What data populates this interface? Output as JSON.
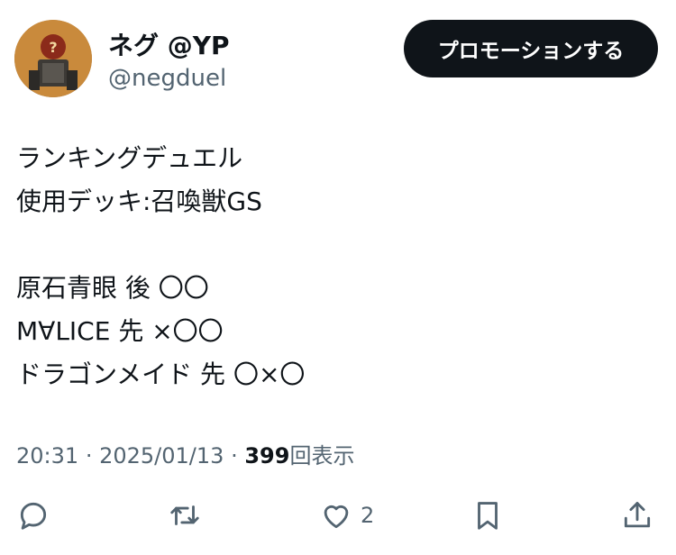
{
  "author": {
    "display_name": "ネグ @YP",
    "handle": "@negduel",
    "avatar_icon": "avatar-icon"
  },
  "header": {
    "promote_label": "プロモーションする"
  },
  "tweet": {
    "lines": [
      "ランキングデュエル",
      "使用デッキ:召喚獣GS",
      "",
      "原石青眼 後 〇〇",
      "M∀LICE 先 ×〇〇",
      "ドラゴンメイド 先 〇×〇"
    ]
  },
  "meta": {
    "time": "20:31",
    "separator": "·",
    "date": "2025/01/13",
    "views_count": "399",
    "views_label": "回表示"
  },
  "actions": {
    "reply_icon": "reply-icon",
    "retweet_icon": "retweet-icon",
    "like_icon": "heart-icon",
    "like_count": "2",
    "bookmark_icon": "bookmark-icon",
    "share_icon": "share-icon"
  },
  "colors": {
    "text": "#0f1419",
    "secondary": "#536471",
    "button_bg": "#0f1419",
    "button_text": "#ffffff"
  }
}
